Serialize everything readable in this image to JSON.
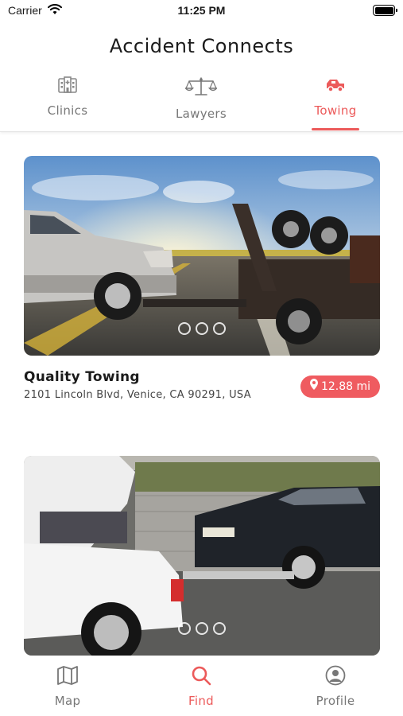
{
  "status_bar": {
    "carrier": "Carrier",
    "time": "11:25 PM"
  },
  "app": {
    "title": "Accident Connects"
  },
  "tabs": [
    {
      "label": "Clinics",
      "icon": "clinic-building-icon",
      "active": false
    },
    {
      "label": "Lawyers",
      "icon": "scales-icon",
      "active": false
    },
    {
      "label": "Towing",
      "icon": "tow-truck-icon",
      "active": true
    }
  ],
  "listings": [
    {
      "name": "Quality Towing",
      "address": "2101 Lincoln Blvd, Venice, CA 90291, USA",
      "distance": "12.88 mi",
      "image": "tow-truck-towing-silver-suv-photo",
      "carousel_pages": 3
    },
    {
      "name": "",
      "address": "",
      "distance": "",
      "image": "white-tow-truck-towing-dark-sedan-photo",
      "carousel_pages": 3
    }
  ],
  "bottom_nav": [
    {
      "label": "Map",
      "icon": "map-icon",
      "active": false
    },
    {
      "label": "Find",
      "icon": "search-icon",
      "active": true
    },
    {
      "label": "Profile",
      "icon": "user-circle-icon",
      "active": false
    }
  ],
  "colors": {
    "accent": "#ec5a5a",
    "badge": "#ef5b60",
    "inactive": "#777777"
  }
}
